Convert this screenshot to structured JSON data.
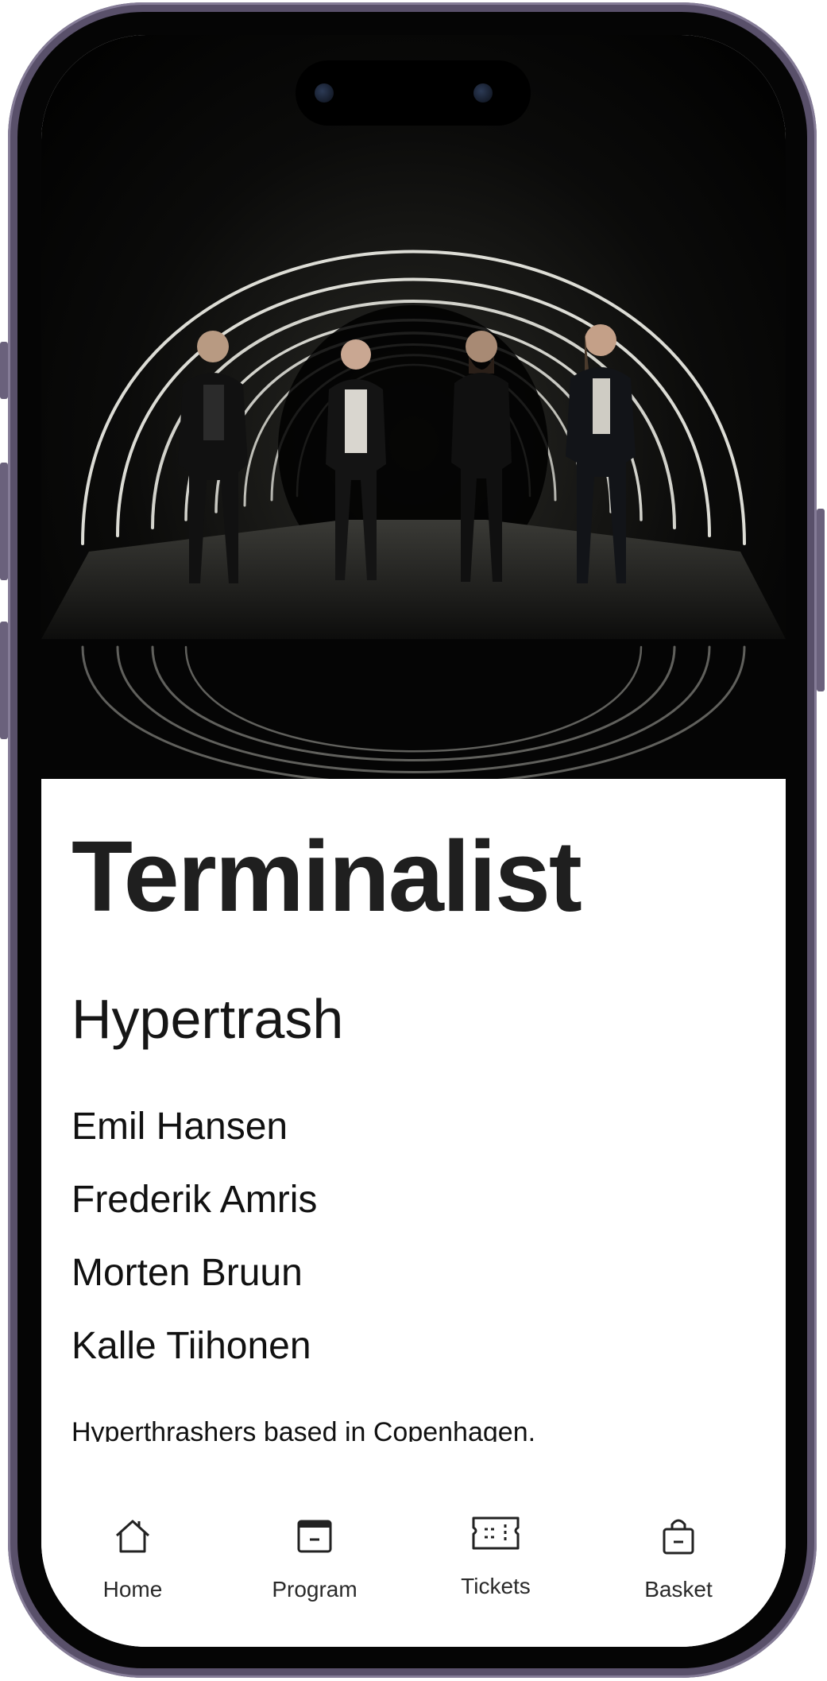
{
  "band": {
    "name": "Terminalist",
    "genre": "Hypertrash",
    "members": [
      "Emil Hansen",
      "Frederik Amris",
      "Morten Bruun",
      "Kalle Tiihonen"
    ],
    "description": "Hyperthrashers based in Copenhagen."
  },
  "nav": [
    {
      "label": "Home",
      "icon": "home-icon"
    },
    {
      "label": "Program",
      "icon": "calendar-icon"
    },
    {
      "label": "Tickets",
      "icon": "ticket-icon"
    },
    {
      "label": "Basket",
      "icon": "shopping-bag-icon"
    }
  ],
  "colors": {
    "frame": "#59506a",
    "text": "#1f1f1f",
    "background": "#ffffff"
  }
}
